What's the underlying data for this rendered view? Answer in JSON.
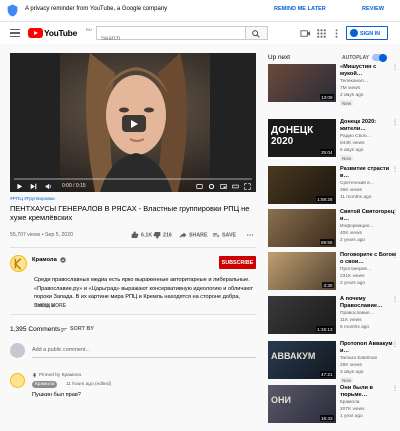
{
  "reminder": {
    "text": "A privacy reminder from YouTube, a Google company",
    "later": "REMIND ME LATER",
    "review": "REVIEW"
  },
  "masthead": {
    "logo": "YouTube",
    "logo_sup": "RU",
    "search_placeholder": "Search",
    "signin": "SIGN IN"
  },
  "player": {
    "time": "0:00 / 0:15",
    "progress": 0.0
  },
  "video": {
    "hashtag": "#РПЦ #Группировки",
    "title": "ПЕНТХАУСЫ ГЕНЕРАЛОВ В РЯСАХ - Властные группировки РПЦ не хуже кремлёвских",
    "meta": "55,707 views • Sep 5, 2020",
    "likes": "6.1K",
    "dislikes": "216",
    "share": "SHARE",
    "save": "SAVE"
  },
  "channel": {
    "name": "Крамола",
    "subscribe": "SUBSCRIBE"
  },
  "description": {
    "text": "Среди православных медиа есть ярко выраженные авторитарные и либеральные. «Православие.ру» и «Царьград» выражают консервативную идеологию и обличают пороки Запада. В их картине мира РПЦ и Кремль находятся на стороне добра, Запад и",
    "show_more": "SHOW MORE"
  },
  "comments": {
    "count": "1,395 Comments",
    "sort": "SORT BY",
    "add_placeholder": "Add a public comment...",
    "pinned": "Pinned by Крамола",
    "author": "Крамола",
    "time": "11 hours ago (edited)",
    "text": "Пушкин был прав?"
  },
  "sidebar": {
    "up_next": "Up next",
    "autoplay": "AUTOPLAY",
    "autoplay_on": true,
    "items": [
      {
        "title": "«Мишустин с мукой…",
        "channel": "Телеканал…",
        "views": "7M views",
        "age": "2 days ago",
        "badge": "New",
        "duration": "13:09"
      },
      {
        "title": "Донецк 2020: жители…",
        "channel": "Радио Своб…",
        "views": "844K views",
        "age": "6 days ago",
        "badge": "New",
        "duration": "25:04"
      },
      {
        "title": "Развитие страсти в…",
        "channel": "Сретенский в…",
        "views": "45K views",
        "age": "11 months ago",
        "badge": "",
        "duration": "1:59:28"
      },
      {
        "title": "Святой Святогорец и…",
        "channel": "Информацио…",
        "views": "40K views",
        "age": "2 years ago",
        "badge": "",
        "duration": "59:55"
      },
      {
        "title": "Поговорите с Богом о свои…",
        "channel": "Протоиерей…",
        "views": "231K views",
        "age": "2 years ago",
        "badge": "",
        "duration": "3:30"
      },
      {
        "title": "А почему Православие…",
        "channel": "Православие…",
        "views": "11K views",
        "age": "6 months ago",
        "badge": "",
        "duration": "1:15:13"
      },
      {
        "title": "Протопоп Аввакум и…",
        "channel": "Tamara Eidelman",
        "views": "28K views",
        "age": "3 days ago",
        "badge": "New",
        "duration": "47:21"
      },
      {
        "title": "Они были в тюрьме…",
        "channel": "Крамола",
        "views": "207K views",
        "age": "1 year ago",
        "badge": "",
        "duration": "18:43"
      }
    ],
    "thumb_texts": [
      "",
      "ДОНЕЦК 2020",
      "",
      "",
      "",
      "",
      "АВВАКУМ",
      "ОНИ"
    ]
  },
  "colors": {
    "accent": "#065fd4",
    "red": "#cc0000",
    "yt_red": "#ff0000"
  }
}
